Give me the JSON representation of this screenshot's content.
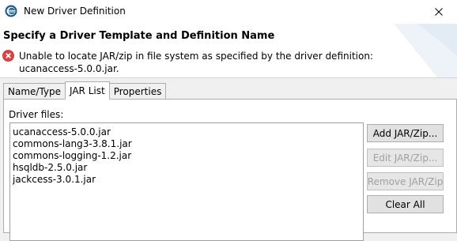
{
  "window": {
    "title": "New Driver Definition",
    "close_glyph": "close-icon"
  },
  "banner": {
    "title": "Specify a Driver Template and Definition Name",
    "error_icon": "error-icon",
    "error_color": "#e04343",
    "error_message": "Unable to locate JAR/zip in file system as specified by the driver definition: ucanaccess-5.0.0.jar."
  },
  "tabs": [
    {
      "label": "Name/Type",
      "active": false
    },
    {
      "label": "JAR List",
      "active": true
    },
    {
      "label": "Properties",
      "active": false
    }
  ],
  "jar_list": {
    "label": "Driver files:",
    "files": [
      "ucanaccess-5.0.0.jar",
      "commons-lang3-3.8.1.jar",
      "commons-logging-1.2.jar",
      "hsqldb-2.5.0.jar",
      "jackcess-3.0.1.jar"
    ],
    "buttons": {
      "add": {
        "label": "Add JAR/Zip...",
        "enabled": true
      },
      "edit": {
        "label": "Edit JAR/Zip...",
        "enabled": false
      },
      "remove": {
        "label": "Remove JAR/Zip",
        "enabled": false
      },
      "clear": {
        "label": "Clear All",
        "enabled": true
      }
    }
  }
}
